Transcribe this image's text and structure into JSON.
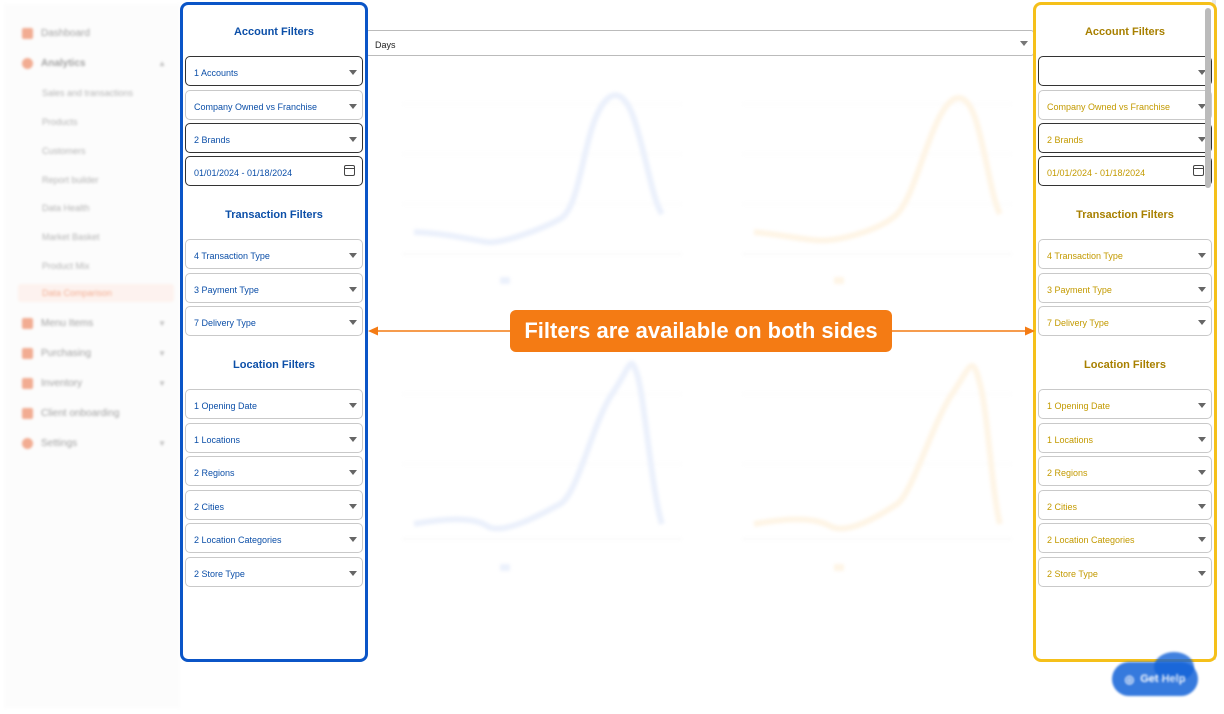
{
  "sidebar": {
    "items": [
      {
        "label": "Dashboard",
        "icon": "dashboard-icon"
      },
      {
        "label": "Analytics",
        "icon": "analytics-icon"
      },
      {
        "label": "Menu Items",
        "icon": "menu-items-icon"
      },
      {
        "label": "Purchasing",
        "icon": "purchasing-icon"
      },
      {
        "label": "Inventory",
        "icon": "inventory-icon"
      },
      {
        "label": "Client onboarding",
        "icon": "client-onboarding-icon"
      },
      {
        "label": "Settings",
        "icon": "gear-icon"
      }
    ],
    "analytics_sub": [
      "Sales and transactions",
      "Products",
      "Customers",
      "Report builder",
      "Data Health",
      "Market Basket",
      "Product Mix",
      "Data Comparison"
    ]
  },
  "main": {
    "days_select": "Days"
  },
  "left_panel": {
    "account_heading": "Account Filters",
    "accounts": "1 Accounts",
    "ownership": "Company Owned vs Franchise",
    "brands": "2 Brands",
    "date_range": "01/01/2024 - 01/18/2024",
    "transaction_heading": "Transaction Filters",
    "transaction_type": "4 Transaction Type",
    "payment_type": "3 Payment Type",
    "delivery_type": "7 Delivery Type",
    "location_heading": "Location Filters",
    "opening_date": "1 Opening Date",
    "locations": "1 Locations",
    "regions": "2 Regions",
    "cities": "2 Cities",
    "location_categories": "2 Location Categories",
    "store_type": "2 Store Type"
  },
  "right_panel": {
    "account_heading": "Account Filters",
    "accounts": "",
    "ownership": "Company Owned vs Franchise",
    "brands": "2 Brands",
    "date_range": "01/01/2024 - 01/18/2024",
    "transaction_heading": "Transaction Filters",
    "transaction_type": "4 Transaction Type",
    "payment_type": "3 Payment Type",
    "delivery_type": "7 Delivery Type",
    "location_heading": "Location Filters",
    "opening_date": "1 Opening Date",
    "locations": "1 Locations",
    "regions": "2 Regions",
    "cities": "2 Cities",
    "location_categories": "2 Location Categories",
    "store_type": "2 Store Type"
  },
  "callout": {
    "text": "Filters are available on both sides"
  },
  "help": {
    "label": "Get Help"
  },
  "colors": {
    "left_accent": "#0b55c7",
    "right_accent": "#f5c01a",
    "callout": "#f47b14",
    "series_a": "#c7d6f5",
    "series_b": "#fde2b8"
  }
}
